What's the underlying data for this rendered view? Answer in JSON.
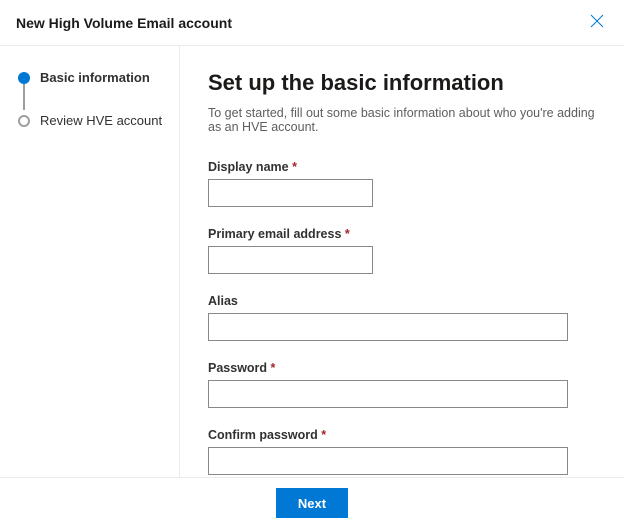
{
  "header": {
    "title": "New High Volume Email account"
  },
  "sidebar": {
    "steps": [
      {
        "label": "Basic information",
        "active": true
      },
      {
        "label": "Review HVE account",
        "active": false
      }
    ]
  },
  "main": {
    "title": "Set up the basic information",
    "description": "To get started, fill out some basic information about who you're adding as an HVE account.",
    "fields": {
      "display_name": {
        "label": "Display name",
        "required": true,
        "value": "",
        "width": "narrow"
      },
      "primary_email": {
        "label": "Primary email address",
        "required": true,
        "value": "",
        "width": "narrow"
      },
      "alias": {
        "label": "Alias",
        "required": false,
        "value": "",
        "width": "wide"
      },
      "password": {
        "label": "Password",
        "required": true,
        "value": "",
        "width": "wide"
      },
      "confirm_password": {
        "label": "Confirm password",
        "required": true,
        "value": "",
        "width": "wide"
      }
    }
  },
  "footer": {
    "next_label": "Next"
  }
}
